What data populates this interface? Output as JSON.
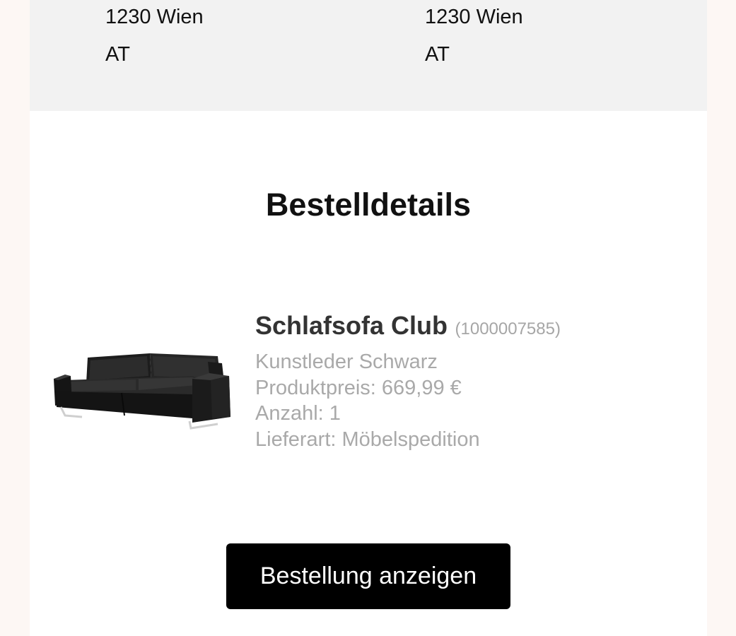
{
  "addresses": {
    "billing": {
      "city": "1230 Wien",
      "country": "AT"
    },
    "shipping": {
      "city": "1230 Wien",
      "country": "AT"
    }
  },
  "order_details": {
    "title": "Bestelldetails",
    "product": {
      "name": "Schlafsofa Club",
      "sku": "(1000007585)",
      "variant": "Kunstleder Schwarz",
      "price": "Produktpreis: 669,99 €",
      "quantity": "Anzahl: 1",
      "delivery": "Lieferart: Möbelspedition",
      "image_icon": "sofa-image"
    },
    "button_label": "Bestellung anzeigen"
  },
  "colors": {
    "page_background": "#fdf7f4",
    "address_background": "#f2f2f2",
    "muted_text": "#a9a9a9",
    "button_background": "#000000",
    "button_text": "#ffffff"
  }
}
